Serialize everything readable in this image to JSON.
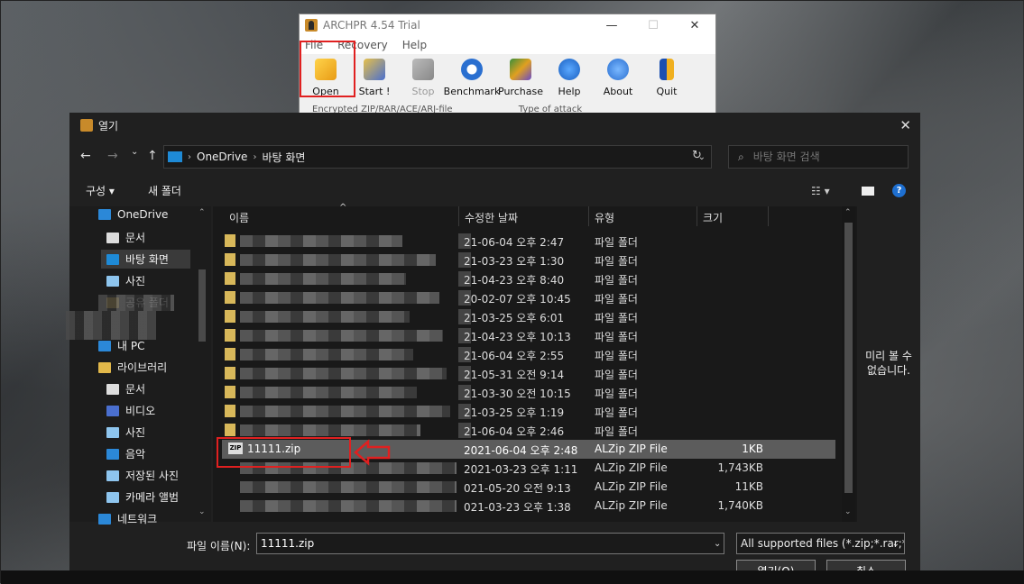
{
  "archpr": {
    "title": "ARCHPR 4.54 Trial",
    "window_controls": [
      "—",
      "☐",
      "✕"
    ],
    "menu": [
      "File",
      "Recovery",
      "Help"
    ],
    "tools": [
      {
        "label": "Open",
        "icon": "open-folder-icon"
      },
      {
        "label": "Start !",
        "icon": "start-keys-icon"
      },
      {
        "label": "Stop",
        "icon": "stop-keys-icon",
        "disabled": true
      },
      {
        "label": "Benchmark",
        "icon": "stopwatch-icon"
      },
      {
        "label": "Purchase",
        "icon": "purchase-icon"
      },
      {
        "label": "Help",
        "icon": "help-icon"
      },
      {
        "label": "About",
        "icon": "info-icon"
      },
      {
        "label": "Quit",
        "icon": "quit-door-icon"
      }
    ],
    "status_left": "Encrypted ZIP/RAR/ACE/ARJ-file",
    "status_right": "Type of attack"
  },
  "dialog": {
    "title": "열기",
    "close": "✕",
    "nav": {
      "back": "←",
      "forward": "→",
      "recent": "⌄",
      "up": "↑",
      "refresh": "↻"
    },
    "breadcrumb": [
      "OneDrive",
      "바탕 화면"
    ],
    "breadcrumb_sep": "›",
    "search_placeholder": "바탕 화면 검색",
    "organize": "구성 ▾",
    "new_folder": "새 폴더",
    "view_toggle": "☷ ▾",
    "help": "?",
    "columns": {
      "name": "이름",
      "date": "수정한 날짜",
      "type": "유형",
      "size": "크기"
    },
    "navpane": [
      {
        "label": "OneDrive",
        "icon": "cloud-icon"
      },
      {
        "label": "문서",
        "icon": "document-icon"
      },
      {
        "label": "바탕 화면",
        "icon": "desktop-icon",
        "selected": true
      },
      {
        "label": "사진",
        "icon": "picture-icon"
      },
      {
        "label": "공유 폴더",
        "icon": "folder-icon"
      },
      {
        "label": "내 PC",
        "icon": "pc-icon"
      },
      {
        "label": "라이브러리",
        "icon": "library-icon"
      },
      {
        "label": "문서",
        "icon": "document-icon"
      },
      {
        "label": "비디오",
        "icon": "video-icon"
      },
      {
        "label": "사진",
        "icon": "picture-icon"
      },
      {
        "label": "음악",
        "icon": "music-icon"
      },
      {
        "label": "저장된 사진",
        "icon": "picture-icon"
      },
      {
        "label": "카메라 앨범",
        "icon": "picture-icon"
      },
      {
        "label": "네트워크",
        "icon": "network-icon"
      }
    ],
    "rows": [
      {
        "name": "",
        "date": "21-06-04 오후 2:47",
        "type": "파일 폴더",
        "size": ""
      },
      {
        "name": "",
        "date": "21-03-23 오후 1:30",
        "type": "파일 폴더",
        "size": ""
      },
      {
        "name": "",
        "date": "21-04-23 오후 8:40",
        "type": "파일 폴더",
        "size": ""
      },
      {
        "name": "",
        "date": "20-02-07 오후 10:45",
        "type": "파일 폴더",
        "size": ""
      },
      {
        "name": "",
        "date": "21-03-25 오후 6:01",
        "type": "파일 폴더",
        "size": ""
      },
      {
        "name": "",
        "date": "21-04-23 오후 10:13",
        "type": "파일 폴더",
        "size": ""
      },
      {
        "name": "",
        "date": "21-06-04 오후 2:55",
        "type": "파일 폴더",
        "size": ""
      },
      {
        "name": "",
        "date": "21-05-31 오전 9:14",
        "type": "파일 폴더",
        "size": ""
      },
      {
        "name": "",
        "date": "21-03-30 오전 10:15",
        "type": "파일 폴더",
        "size": ""
      },
      {
        "name": "",
        "date": "21-03-25 오후 1:19",
        "type": "파일 폴더",
        "size": ""
      },
      {
        "name": "",
        "date": "21-06-04 오후 2:46",
        "type": "파일 폴더",
        "size": ""
      },
      {
        "name": "11111.zip",
        "date": "2021-06-04 오후 2:48",
        "type": "ALZip ZIP File",
        "size": "1KB",
        "selected": true
      },
      {
        "name": "",
        "date": "2021-03-23 오후 1:11",
        "type": "ALZip ZIP File",
        "size": "1,743KB"
      },
      {
        "name": "",
        "date": "021-05-20 오전 9:13",
        "type": "ALZip ZIP File",
        "size": "11KB"
      },
      {
        "name": "",
        "date": "021-03-23 오후 1:38",
        "type": "ALZip ZIP File",
        "size": "1,740KB"
      }
    ],
    "zip_badge": "ZIP",
    "preview": "미리 볼 수 없습니다.",
    "filename_label": "파일 이름(N):",
    "filename_value": "11111.zip",
    "filter": "All supported files (*.zip;*.rar;*.",
    "open_button": "열기(O)",
    "cancel_button": "취소"
  }
}
